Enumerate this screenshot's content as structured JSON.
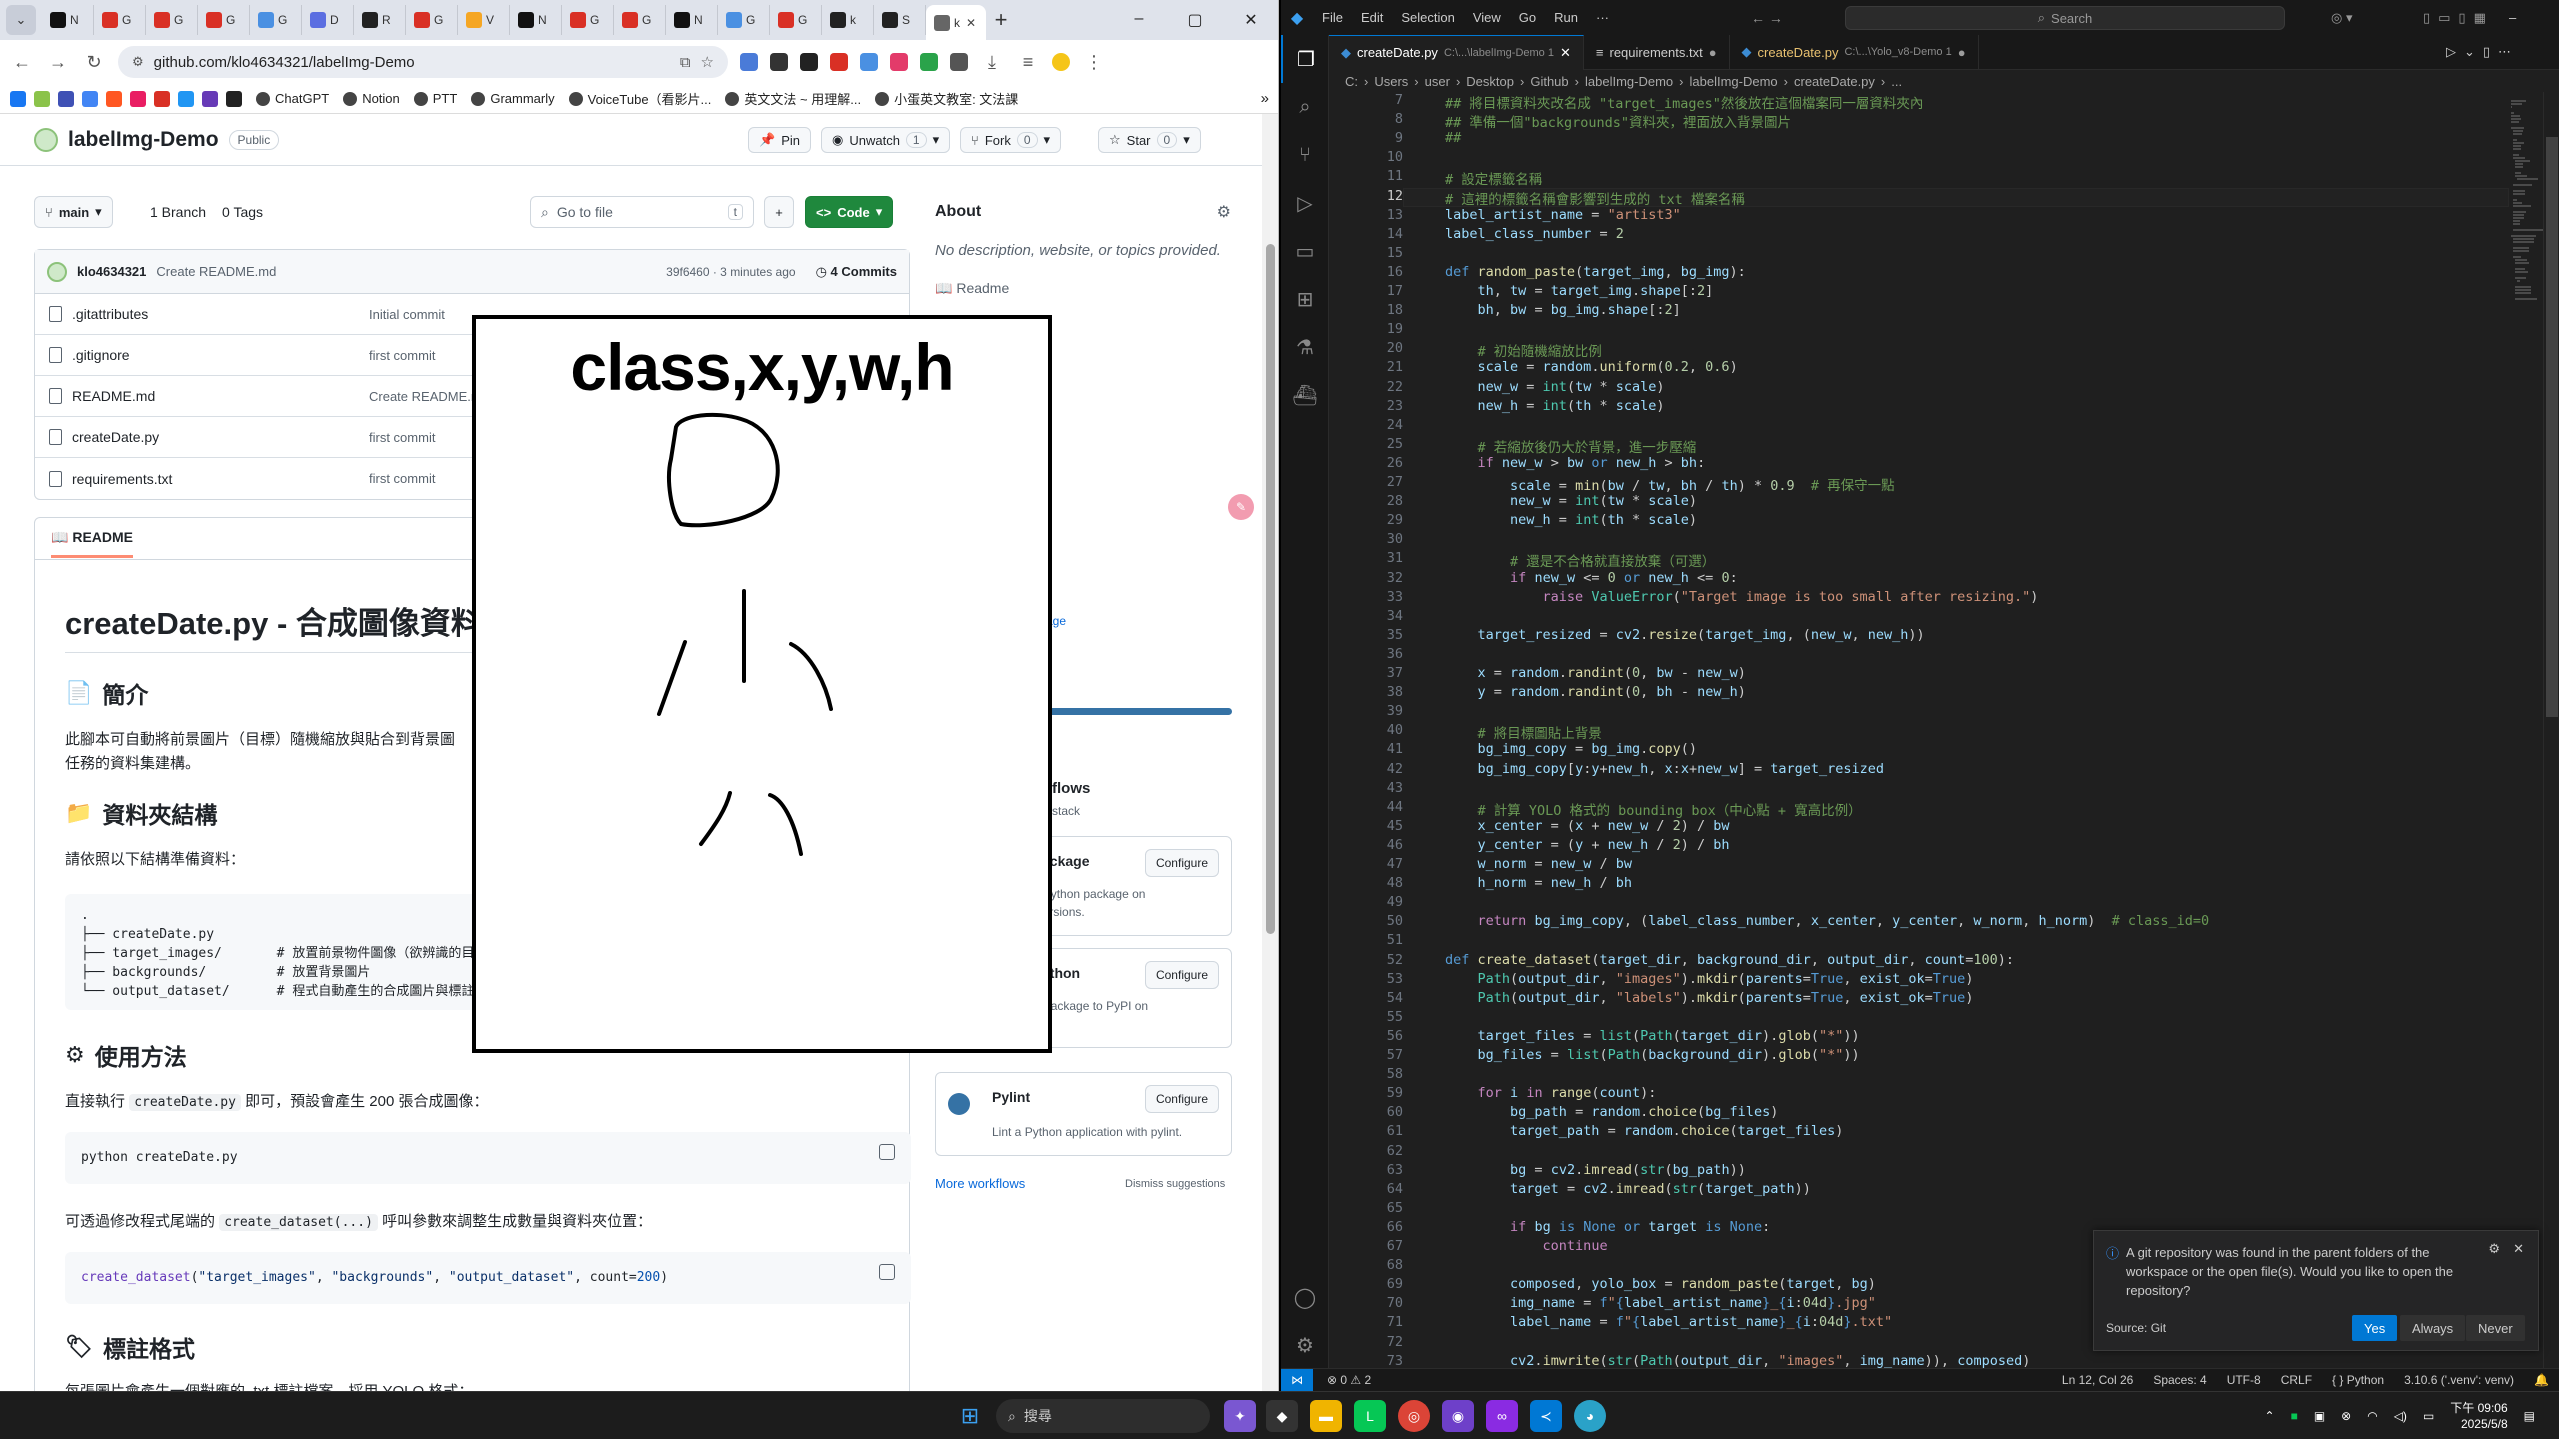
{
  "chrome": {
    "tab_menu_icon": "chevron-down-icon",
    "tabs": [
      {
        "label": "N",
        "color": "#111111"
      },
      {
        "label": "G",
        "color": "#d93025"
      },
      {
        "label": "G",
        "color": "#d93025"
      },
      {
        "label": "G",
        "color": "#d93025"
      },
      {
        "label": "G",
        "color": "#4a90e2"
      },
      {
        "label": "D",
        "color": "#5b6ee1"
      },
      {
        "label": "R",
        "color": "#222222"
      },
      {
        "label": "G",
        "color": "#d93025"
      },
      {
        "label": "V",
        "color": "#f5a623"
      },
      {
        "label": "N",
        "color": "#111111"
      },
      {
        "label": "G",
        "color": "#d93025"
      },
      {
        "label": "G",
        "color": "#d93025"
      },
      {
        "label": "N",
        "color": "#111111"
      },
      {
        "label": "G",
        "color": "#4a90e2"
      },
      {
        "label": "G",
        "color": "#d93025"
      },
      {
        "label": "k",
        "color": "#222222"
      },
      {
        "label": "S",
        "color": "#222222"
      }
    ],
    "active_tab": {
      "label": "k",
      "close": "✕"
    },
    "new_tab": "+",
    "window_controls": [
      "–",
      "▢",
      "✕"
    ],
    "url": "github.com/klo4634321/labelImg-Demo",
    "bookmarks": [
      {
        "label": "ChatGPT"
      },
      {
        "label": "Notion"
      },
      {
        "label": "PTT"
      },
      {
        "label": "Grammarly"
      },
      {
        "label": "VoiceTube（看影片..."
      },
      {
        "label": "英文文法 ~ 用理解..."
      },
      {
        "label": "小蛋英文教室: 文法課"
      }
    ],
    "bookmarks_more": "»"
  },
  "github": {
    "repo_name": "labelImg-Demo",
    "visibility": "Public",
    "pin": "Pin",
    "unwatch": "Unwatch",
    "unwatch_count": "1",
    "fork": "Fork",
    "fork_count": "0",
    "star": "Star",
    "star_count": "0",
    "branch": "main",
    "branches": "1 Branch",
    "tags": "0 Tags",
    "goto_placeholder": "Go to file",
    "goto_shortcut": "t",
    "code_button": "Code",
    "commit": {
      "author": "klo4634321",
      "message": "Create README.md",
      "hash": "39f6460 · 3 minutes ago",
      "count": "4 Commits"
    },
    "files": [
      {
        "name": ".gitattributes",
        "msg": "Initial commit"
      },
      {
        "name": ".gitignore",
        "msg": "first commit"
      },
      {
        "name": "README.md",
        "msg": "Create README.md"
      },
      {
        "name": "createDate.py",
        "msg": "first commit"
      },
      {
        "name": "requirements.txt",
        "msg": "first commit"
      }
    ],
    "readme_tab": "README",
    "about_title": "About",
    "about_desc": "No description, website, or topics provided.",
    "about_readme": "Readme",
    "about_frag1": "d",
    "about_frag2": "age",
    "workflows_frag": "flows",
    "workflows_sub": "stack",
    "workflows": [
      {
        "name": "ackage",
        "desc": "test a Python package on",
        "desc2": "thon versions.",
        "btn": "Configure"
      },
      {
        "name": "ython",
        "desc": "ython Package to PyPI on",
        "desc2": "",
        "btn": "Configure"
      },
      {
        "name": "Pylint",
        "desc": "Lint a Python application with pylint.",
        "desc2": "",
        "btn": "Configure"
      }
    ],
    "more_workflows": "More workflows",
    "dismiss": "Dismiss suggestions",
    "readme": {
      "title": "createDate.py - 合成圖像資料",
      "intro_h": "簡介",
      "intro_p1": "此腳本可自動將前景圖片（目標）隨機縮放與貼合到背景圖",
      "intro_p2": "任務的資料集建構。",
      "folder_h": "資料夾結構",
      "folder_p": "請依照以下結構準備資料：",
      "folder_code": ".\n├── createDate.py\n├── target_images/       # 放置前景物件圖像（欲辨識的目\n├── backgrounds/         # 放置背景圖片\n└── output_dataset/      # 程式自動產生的合成圖片與標註",
      "usage_h": "使用方法",
      "usage_p_pre": "直接執行",
      "usage_p_code": "createDate.py",
      "usage_p_post": "即可，預設會產生 200 張合成圖像：",
      "usage_code": "python createDate.py",
      "mod_p_pre": "可透過修改程式尾端的",
      "mod_p_code": "create_dataset(...)",
      "mod_p_post": "呼叫參數來調整生成數量與資料夾位置：",
      "label_h": "標註格式",
      "label_p": "每張圖片會產生一個對應的 .txt 標註檔案，採用 YOLO 格式："
    }
  },
  "overlay": {
    "text": "class,x,y,w,h"
  },
  "vscode": {
    "menu": [
      "File",
      "Edit",
      "Selection",
      "View",
      "Go",
      "Run",
      "···"
    ],
    "search": "Search",
    "tabs": [
      {
        "name": "createDate.py",
        "path": "C:\\...\\labelImg-Demo 1",
        "state": "✕",
        "active": true
      },
      {
        "name": "requirements.txt",
        "path": "",
        "state": "●",
        "active": false
      },
      {
        "name": "createDate.py",
        "path": "C:\\...\\Yolo_v8-Demo 1",
        "state": "●",
        "active": false
      }
    ],
    "breadcrumb": [
      "C:",
      "Users",
      "user",
      "Desktop",
      "Github",
      "labelImg-Demo",
      "labelImg-Demo",
      "createDate.py",
      "..."
    ],
    "current_line": 12,
    "code": [
      {
        "n": 7,
        "h": "<span class=\"cm\">## 將目標資料夾改名成 \"target_images\"然後放在這個檔案同一層資料夾內</span>"
      },
      {
        "n": 8,
        "h": "<span class=\"cm\">## 準備一個\"backgrounds\"資料夾，裡面放入背景圖片</span>"
      },
      {
        "n": 9,
        "h": "<span class=\"cm\">##</span>"
      },
      {
        "n": 10,
        "h": ""
      },
      {
        "n": 11,
        "h": "<span class=\"cm\"># 設定標籤名稱</span>"
      },
      {
        "n": 12,
        "h": "<span class=\"cm\"># 這裡的標籤名稱會影響到生成的 txt 檔案名稱</span>"
      },
      {
        "n": 13,
        "h": "<span class=\"va\">label_artist_name</span> = <span class=\"st\">\"artist3\"</span>"
      },
      {
        "n": 14,
        "h": "<span class=\"va\">label_class_number</span> = <span class=\"nu\">2</span>"
      },
      {
        "n": 15,
        "h": ""
      },
      {
        "n": 16,
        "h": "<span class=\"df\">def</span> <span class=\"fn\">random_paste</span>(<span class=\"va\">target_img</span>, <span class=\"va\">bg_img</span>):"
      },
      {
        "n": 17,
        "h": "    <span class=\"va\">th</span>, <span class=\"va\">tw</span> = <span class=\"va\">target_img</span>.<span class=\"va\">shape</span>[:<span class=\"nu\">2</span>]"
      },
      {
        "n": 18,
        "h": "    <span class=\"va\">bh</span>, <span class=\"va\">bw</span> = <span class=\"va\">bg_img</span>.<span class=\"va\">shape</span>[:<span class=\"nu\">2</span>]"
      },
      {
        "n": 19,
        "h": ""
      },
      {
        "n": 20,
        "h": "    <span class=\"cm\"># 初始隨機縮放比例</span>"
      },
      {
        "n": 21,
        "h": "    <span class=\"va\">scale</span> = <span class=\"va\">random</span>.<span class=\"fn\">uniform</span>(<span class=\"nu\">0.2</span>, <span class=\"nu\">0.6</span>)"
      },
      {
        "n": 22,
        "h": "    <span class=\"va\">new_w</span> = <span class=\"cls\">int</span>(<span class=\"va\">tw</span> * <span class=\"va\">scale</span>)"
      },
      {
        "n": 23,
        "h": "    <span class=\"va\">new_h</span> = <span class=\"cls\">int</span>(<span class=\"va\">th</span> * <span class=\"va\">scale</span>)"
      },
      {
        "n": 24,
        "h": ""
      },
      {
        "n": 25,
        "h": "    <span class=\"cm\"># 若縮放後仍大於背景，進一步壓縮</span>"
      },
      {
        "n": 26,
        "h": "    <span class=\"kw\">if</span> <span class=\"va\">new_w</span> &gt; <span class=\"va\">bw</span> <span class=\"df\">or</span> <span class=\"va\">new_h</span> &gt; <span class=\"va\">bh</span>:"
      },
      {
        "n": 27,
        "h": "        <span class=\"va\">scale</span> = <span class=\"fn\">min</span>(<span class=\"va\">bw</span> / <span class=\"va\">tw</span>, <span class=\"va\">bh</span> / <span class=\"va\">th</span>) * <span class=\"nu\">0.9</span>  <span class=\"cm\"># 再保守一點</span>"
      },
      {
        "n": 28,
        "h": "        <span class=\"va\">new_w</span> = <span class=\"cls\">int</span>(<span class=\"va\">tw</span> * <span class=\"va\">scale</span>)"
      },
      {
        "n": 29,
        "h": "        <span class=\"va\">new_h</span> = <span class=\"cls\">int</span>(<span class=\"va\">th</span> * <span class=\"va\">scale</span>)"
      },
      {
        "n": 30,
        "h": ""
      },
      {
        "n": 31,
        "h": "        <span class=\"cm\"># 還是不合格就直接放棄（可選）</span>"
      },
      {
        "n": 32,
        "h": "        <span class=\"kw\">if</span> <span class=\"va\">new_w</span> &lt;= <span class=\"nu\">0</span> <span class=\"df\">or</span> <span class=\"va\">new_h</span> &lt;= <span class=\"nu\">0</span>:"
      },
      {
        "n": 33,
        "h": "            <span class=\"kw\">raise</span> <span class=\"cls\">ValueError</span>(<span class=\"st\">\"Target image is too small after resizing.\"</span>)"
      },
      {
        "n": 34,
        "h": ""
      },
      {
        "n": 35,
        "h": "    <span class=\"va\">target_resized</span> = <span class=\"va\">cv2</span>.<span class=\"fn\">resize</span>(<span class=\"va\">target_img</span>, (<span class=\"va\">new_w</span>, <span class=\"va\">new_h</span>))"
      },
      {
        "n": 36,
        "h": ""
      },
      {
        "n": 37,
        "h": "    <span class=\"va\">x</span> = <span class=\"va\">random</span>.<span class=\"fn\">randint</span>(<span class=\"nu\">0</span>, <span class=\"va\">bw</span> - <span class=\"va\">new_w</span>)"
      },
      {
        "n": 38,
        "h": "    <span class=\"va\">y</span> = <span class=\"va\">random</span>.<span class=\"fn\">randint</span>(<span class=\"nu\">0</span>, <span class=\"va\">bh</span> - <span class=\"va\">new_h</span>)"
      },
      {
        "n": 39,
        "h": ""
      },
      {
        "n": 40,
        "h": "    <span class=\"cm\"># 將目標圖貼上背景</span>"
      },
      {
        "n": 41,
        "h": "    <span class=\"va\">bg_img_copy</span> = <span class=\"va\">bg_img</span>.<span class=\"fn\">copy</span>()"
      },
      {
        "n": 42,
        "h": "    <span class=\"va\">bg_img_copy</span>[<span class=\"va\">y</span>:<span class=\"va\">y</span>+<span class=\"va\">new_h</span>, <span class=\"va\">x</span>:<span class=\"va\">x</span>+<span class=\"va\">new_w</span>] = <span class=\"va\">target_resized</span>"
      },
      {
        "n": 43,
        "h": ""
      },
      {
        "n": 44,
        "h": "    <span class=\"cm\"># 計算 YOLO 格式的 bounding box（中心點 + 寬高比例）</span>"
      },
      {
        "n": 45,
        "h": "    <span class=\"va\">x_center</span> = (<span class=\"va\">x</span> + <span class=\"va\">new_w</span> / <span class=\"nu\">2</span>) / <span class=\"va\">bw</span>"
      },
      {
        "n": 46,
        "h": "    <span class=\"va\">y_center</span> = (<span class=\"va\">y</span> + <span class=\"va\">new_h</span> / <span class=\"nu\">2</span>) / <span class=\"va\">bh</span>"
      },
      {
        "n": 47,
        "h": "    <span class=\"va\">w_norm</span> = <span class=\"va\">new_w</span> / <span class=\"va\">bw</span>"
      },
      {
        "n": 48,
        "h": "    <span class=\"va\">h_norm</span> = <span class=\"va\">new_h</span> / <span class=\"va\">bh</span>"
      },
      {
        "n": 49,
        "h": ""
      },
      {
        "n": 50,
        "h": "    <span class=\"kw\">return</span> <span class=\"va\">bg_img_copy</span>, (<span class=\"va\">label_class_number</span>, <span class=\"va\">x_center</span>, <span class=\"va\">y_center</span>, <span class=\"va\">w_norm</span>, <span class=\"va\">h_norm</span>)  <span class=\"cm\"># class_id=0</span>"
      },
      {
        "n": 51,
        "h": ""
      },
      {
        "n": 52,
        "h": "<span class=\"df\">def</span> <span class=\"fn\">create_dataset</span>(<span class=\"va\">target_dir</span>, <span class=\"va\">background_dir</span>, <span class=\"va\">output_dir</span>, <span class=\"va\">count</span>=<span class=\"nu\">100</span>):"
      },
      {
        "n": 53,
        "h": "    <span class=\"cls\">Path</span>(<span class=\"va\">output_dir</span>, <span class=\"st\">\"images\"</span>).<span class=\"fn\">mkdir</span>(<span class=\"va\">parents</span>=<span class=\"df\">True</span>, <span class=\"va\">exist_ok</span>=<span class=\"df\">True</span>)"
      },
      {
        "n": 54,
        "h": "    <span class=\"cls\">Path</span>(<span class=\"va\">output_dir</span>, <span class=\"st\">\"labels\"</span>).<span class=\"fn\">mkdir</span>(<span class=\"va\">parents</span>=<span class=\"df\">True</span>, <span class=\"va\">exist_ok</span>=<span class=\"df\">True</span>)"
      },
      {
        "n": 55,
        "h": ""
      },
      {
        "n": 56,
        "h": "    <span class=\"va\">target_files</span> = <span class=\"cls\">list</span>(<span class=\"cls\">Path</span>(<span class=\"va\">target_dir</span>).<span class=\"fn\">glob</span>(<span class=\"st\">\"*\"</span>))"
      },
      {
        "n": 57,
        "h": "    <span class=\"va\">bg_files</span> = <span class=\"cls\">list</span>(<span class=\"cls\">Path</span>(<span class=\"va\">background_dir</span>).<span class=\"fn\">glob</span>(<span class=\"st\">\"*\"</span>))"
      },
      {
        "n": 58,
        "h": ""
      },
      {
        "n": 59,
        "h": "    <span class=\"kw\">for</span> <span class=\"va\">i</span> <span class=\"kw\">in</span> <span class=\"fn\">range</span>(<span class=\"va\">count</span>):"
      },
      {
        "n": 60,
        "h": "        <span class=\"va\">bg_path</span> = <span class=\"va\">random</span>.<span class=\"fn\">choice</span>(<span class=\"va\">bg_files</span>)"
      },
      {
        "n": 61,
        "h": "        <span class=\"va\">target_path</span> = <span class=\"va\">random</span>.<span class=\"fn\">choice</span>(<span class=\"va\">target_files</span>)"
      },
      {
        "n": 62,
        "h": ""
      },
      {
        "n": 63,
        "h": "        <span class=\"va\">bg</span> = <span class=\"va\">cv2</span>.<span class=\"fn\">imread</span>(<span class=\"cls\">str</span>(<span class=\"va\">bg_path</span>))"
      },
      {
        "n": 64,
        "h": "        <span class=\"va\">target</span> = <span class=\"va\">cv2</span>.<span class=\"fn\">imread</span>(<span class=\"cls\">str</span>(<span class=\"va\">target_path</span>))"
      },
      {
        "n": 65,
        "h": ""
      },
      {
        "n": 66,
        "h": "        <span class=\"kw\">if</span> <span class=\"va\">bg</span> <span class=\"df\">is</span> <span class=\"df\">None</span> <span class=\"df\">or</span> <span class=\"va\">target</span> <span class=\"df\">is</span> <span class=\"df\">None</span>:"
      },
      {
        "n": 67,
        "h": "            <span class=\"kw\">continue</span>"
      },
      {
        "n": 68,
        "h": ""
      },
      {
        "n": 69,
        "h": "        <span class=\"va\">composed</span>, <span class=\"va\">yolo_box</span> = <span class=\"fn\">random_paste</span>(<span class=\"va\">target</span>, <span class=\"va\">bg</span>)"
      },
      {
        "n": 70,
        "h": "        <span class=\"va\">img_name</span> = <span class=\"df\">f</span><span class=\"st\">\"</span><span class=\"df\">{</span><span class=\"va\">label_artist_name</span><span class=\"df\">}</span><span class=\"st\">_</span><span class=\"df\">{</span><span class=\"va\">i</span>:<span class=\"nu\">04d</span><span class=\"df\">}</span><span class=\"st\">.jpg\"</span>"
      },
      {
        "n": 71,
        "h": "        <span class=\"va\">label_name</span> = <span class=\"df\">f</span><span class=\"st\">\"</span><span class=\"df\">{</span><span class=\"va\">label_artist_name</span><span class=\"df\">}</span><span class=\"st\">_</span><span class=\"df\">{</span><span class=\"va\">i</span>:<span class=\"nu\">04d</span><span class=\"df\">}</span><span class=\"st\">.txt\"</span>"
      },
      {
        "n": 72,
        "h": ""
      },
      {
        "n": 73,
        "h": "        <span class=\"va\">cv2</span>.<span class=\"fn\">imwrite</span>(<span class=\"cls\">str</span>(<span class=\"cls\">Path</span>(<span class=\"va\">output_dir</span>, <span class=\"st\">\"images\"</span>, <span class=\"va\">img_name</span>)), <span class=\"va\">composed</span>)"
      }
    ],
    "notification": {
      "text": "A git repository was found in the parent folders of the workspace or the open file(s). Would you like to open the repository?",
      "source": "Source: Git",
      "yes": "Yes",
      "always": "Always",
      "never": "Never"
    },
    "status": {
      "problems": "⊗ 0 ⚠ 2",
      "position": "Ln 12, Col 26",
      "spaces": "Spaces: 4",
      "encoding": "UTF-8",
      "eol": "CRLF",
      "language": "Python",
      "interpreter": "3.10.6 ('.venv': venv)"
    }
  },
  "taskbar": {
    "search_placeholder": "搜尋",
    "time": "下午 09:06",
    "date": "2025/5/8"
  }
}
